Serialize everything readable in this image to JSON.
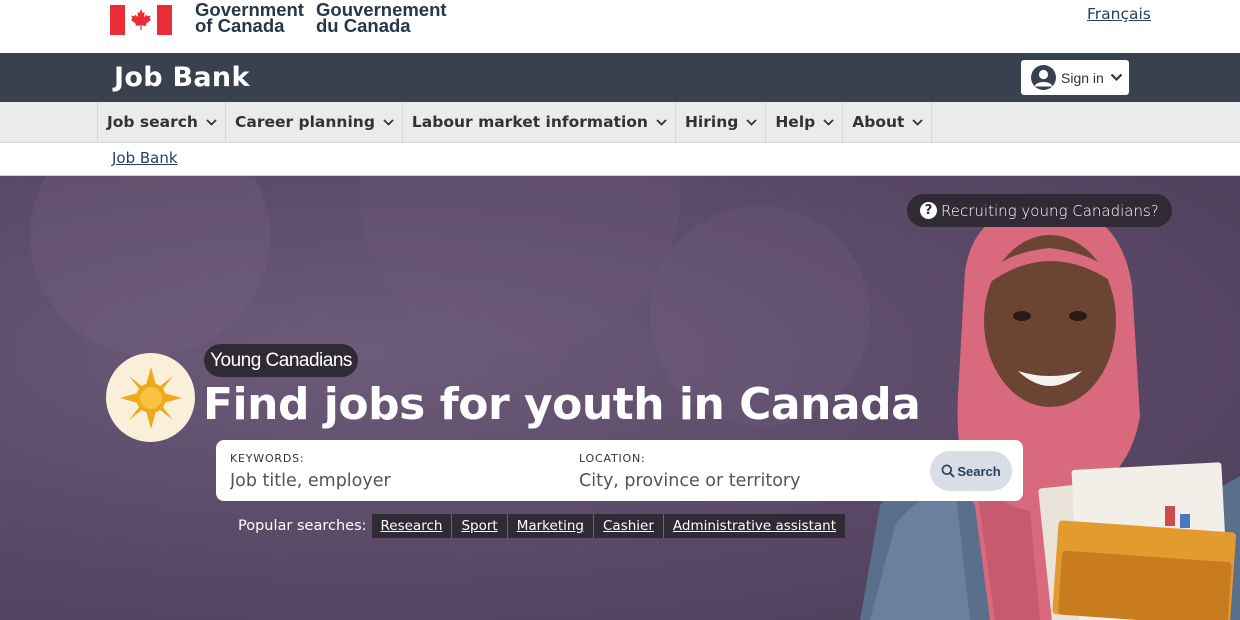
{
  "gov_header": {
    "wordmark_en_line1": "Government",
    "wordmark_en_line2": "of Canada",
    "wordmark_fr_line1": "Gouvernement",
    "wordmark_fr_line2": "du Canada",
    "language_link": "Français",
    "flag_color": "#eb2d37"
  },
  "app_banner": {
    "title": "Job Bank",
    "sign_in_label": "Sign in",
    "background": "#38414d"
  },
  "nav": {
    "items": [
      {
        "label": "Job search",
        "icon": "chevron-down-icon"
      },
      {
        "label": "Career planning",
        "icon": "chevron-down-icon"
      },
      {
        "label": "Labour market information",
        "icon": "chevron-down-icon"
      },
      {
        "label": "Hiring",
        "icon": "chevron-down-icon"
      },
      {
        "label": "Help",
        "icon": "chevron-down-icon"
      },
      {
        "label": "About",
        "icon": "chevron-down-icon"
      }
    ]
  },
  "breadcrumb": {
    "items": [
      "Job Bank"
    ]
  },
  "hero": {
    "recruit_link": "Recruiting young Canadians?",
    "badge_icon": "sun-icon",
    "tag": "Young Canadians",
    "title": "Find jobs for youth in Canada",
    "search": {
      "keywords_label": "Keywords:",
      "keywords_placeholder": "Job title, employer",
      "location_label": "Location:",
      "location_placeholder": "City, province or territory",
      "button_label": "Search"
    },
    "popular_label": "Popular searches:",
    "popular_searches": [
      "Research",
      "Sport",
      "Marketing",
      "Cashier",
      "Administrative assistant"
    ]
  }
}
